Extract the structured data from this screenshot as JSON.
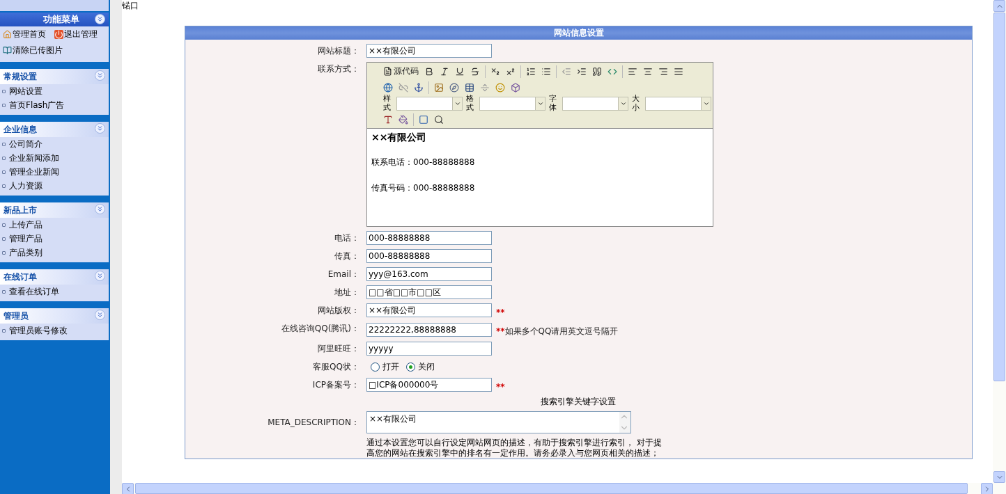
{
  "sidebar": {
    "title": "功能菜单",
    "quick_links": [
      {
        "kind": "home",
        "label": "管理首页"
      },
      {
        "kind": "exit",
        "label": "退出管理"
      },
      {
        "kind": "clear",
        "label": "清除已传图片"
      }
    ],
    "groups": [
      {
        "title": "常规设置",
        "items": [
          "网站设置",
          "首页Flash广告"
        ]
      },
      {
        "title": "企业信息",
        "items": [
          "公司简介",
          "企业新闻添加",
          "管理企业新闻",
          "人力资源"
        ]
      },
      {
        "title": "新品上市",
        "items": [
          "上传产品",
          "管理产品",
          "产品类别"
        ]
      },
      {
        "title": "在线订单",
        "items": [
          "查看在线订单"
        ]
      },
      {
        "title": "管理员",
        "items": [
          "管理员账号修改"
        ]
      }
    ]
  },
  "top_text": "锘口",
  "panel": {
    "title": "网站信息设置",
    "fields": [
      {
        "kind": "text",
        "label": "网站标题：",
        "value": "××有限公司"
      },
      {
        "kind": "editor",
        "label": "联系方式：",
        "source_label": "源代码",
        "selects": [
          "样式",
          "格式",
          "字体",
          "大小"
        ],
        "heading": "××有限公司",
        "lines": [
          "联系电话：000-88888888",
          "传真号码：000-88888888"
        ]
      },
      {
        "kind": "text",
        "label": "电话：",
        "value": "000-88888888"
      },
      {
        "kind": "text",
        "label": "传真：",
        "value": "000-88888888"
      },
      {
        "kind": "text",
        "label": "Email：",
        "value": "yyy@163.com"
      },
      {
        "kind": "text",
        "label": "地址：",
        "value": "□□省□□市□□区"
      },
      {
        "kind": "text",
        "label": "网站版权：",
        "value": "××有限公司",
        "mark": "**"
      },
      {
        "kind": "text",
        "label": "在线咨询QQ(腾讯)：",
        "value": "22222222,88888888",
        "mark": "**",
        "hint": "如果多个QQ请用英文逗号隔开"
      },
      {
        "kind": "text",
        "label": "阿里旺旺：",
        "value": "yyyyy"
      },
      {
        "kind": "radio",
        "label": "客服QQ状：",
        "options": [
          {
            "label": "打开",
            "selected": false
          },
          {
            "label": "关闭",
            "selected": true
          }
        ]
      },
      {
        "kind": "text",
        "label": "ICP备案号：",
        "value": "□ICP备000000号",
        "mark": "**"
      },
      {
        "kind": "section",
        "label": "搜索引擎关键字设置"
      },
      {
        "kind": "textarea",
        "label": "META_DESCRIPTION：",
        "value": "××有限公司",
        "help": "通过本设置您可以自行设定网站网页的描述，有助于搜索引擎进行索引， 对于提高您的网站在搜索引擎中的排名有一定作用。请务必录入与您网页相关的描述；"
      }
    ]
  }
}
